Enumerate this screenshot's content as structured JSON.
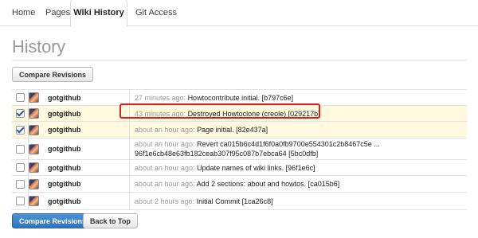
{
  "tabs": [
    {
      "label": "Home",
      "active": false
    },
    {
      "label": "Pages",
      "active": false
    },
    {
      "label": "Wiki History",
      "active": true
    },
    {
      "label": "Git Access",
      "active": false
    }
  ],
  "page_title": "History",
  "toolbar": {
    "compare_label": "Compare Revisions"
  },
  "footer": {
    "compare_label": "Compare Revisions",
    "back_to_top_label": "Back to Top"
  },
  "revisions": [
    {
      "checked": false,
      "author": "gotgithub",
      "time": "27 minutes ago:",
      "message": "Howtocontribute initial. [b797c6e]"
    },
    {
      "checked": true,
      "author": "gotgithub",
      "time": "43 minutes ago:",
      "message": "Destroyed Howtoclone (creole) [029217b]"
    },
    {
      "checked": true,
      "author": "gotgithub",
      "time": "about an hour ago:",
      "message": "Page initial. [82e437a]"
    },
    {
      "checked": false,
      "author": "gotgithub",
      "time": "about an hour ago:",
      "message": "Revert ca015b6c4d1f6f0a0fb9700e554301c2b8467c5e ...",
      "message_line2": "96f1e6cb48e63fb182ceab307f95c087b7ebca64 [5bc0dfb]"
    },
    {
      "checked": false,
      "author": "gotgithub",
      "time": "about an hour ago:",
      "message": "Update names of wiki links. [96f1e6c]"
    },
    {
      "checked": false,
      "author": "gotgithub",
      "time": "about an hour ago:",
      "message": "Add 2 sections: about and howtos. [ca015b6]"
    },
    {
      "checked": false,
      "author": "gotgithub",
      "time": "about 2 hours ago:",
      "message": "Initial Commit [1ca26c8]"
    }
  ],
  "annotation_color": "#d91e1e"
}
